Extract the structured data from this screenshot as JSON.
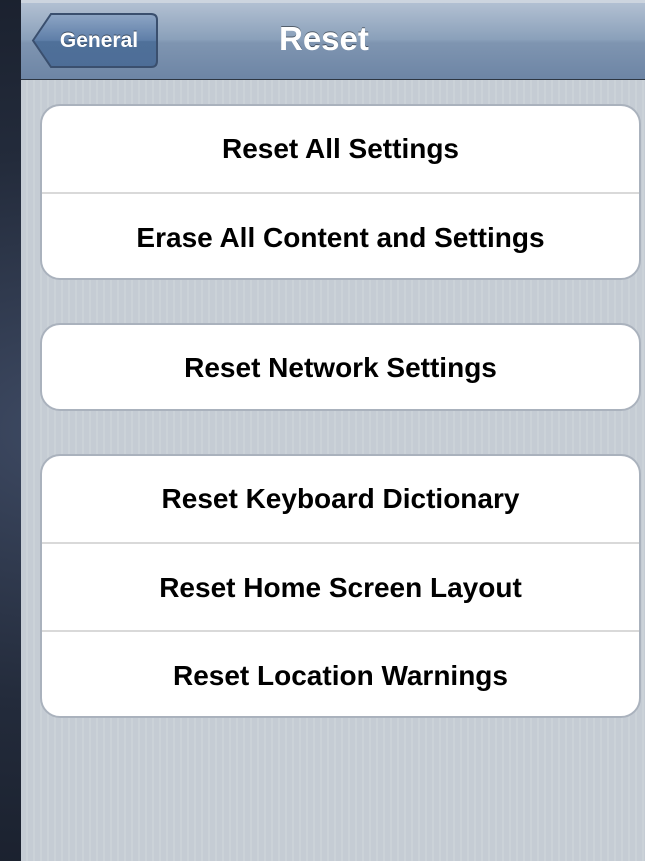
{
  "nav": {
    "back_label": "General",
    "title": "Reset"
  },
  "groups": [
    {
      "items": [
        {
          "label": "Reset All Settings"
        },
        {
          "label": "Erase All Content and Settings"
        }
      ]
    },
    {
      "items": [
        {
          "label": "Reset Network Settings"
        }
      ]
    },
    {
      "items": [
        {
          "label": "Reset Keyboard Dictionary"
        },
        {
          "label": "Reset Home Screen Layout"
        },
        {
          "label": "Reset Location Warnings"
        }
      ]
    }
  ],
  "colors": {
    "nav_bar": "#7f95b1",
    "background": "#c5ccd4",
    "cell_background": "#ffffff",
    "cell_text": "#000000"
  }
}
